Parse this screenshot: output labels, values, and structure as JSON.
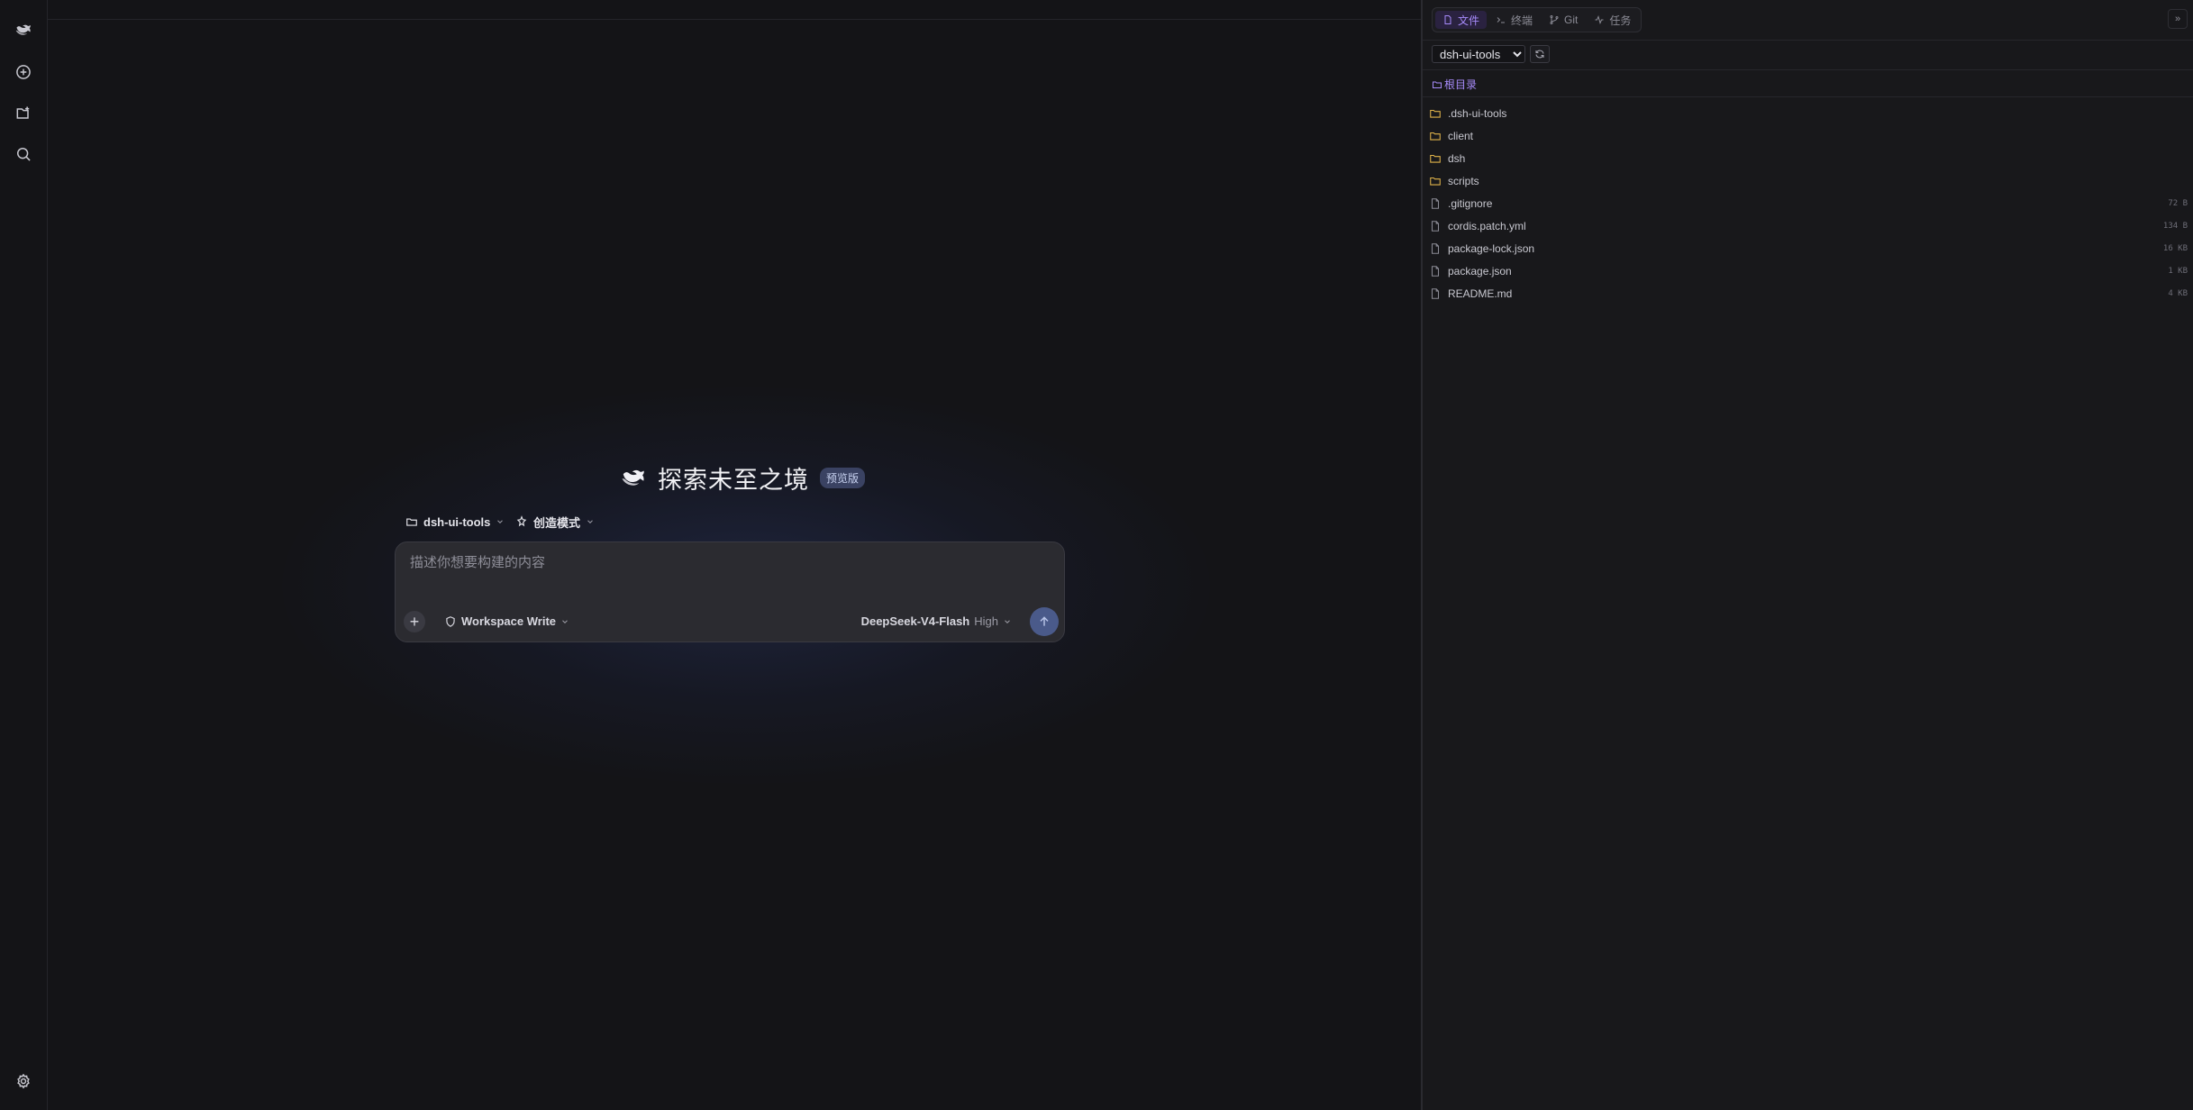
{
  "hero": {
    "title": "探索未至之境",
    "badge": "预览版"
  },
  "context": {
    "project": "dsh-ui-tools",
    "mode": "创造模式"
  },
  "composer": {
    "placeholder": "描述你想要构建的内容",
    "permission": "Workspace Write",
    "model": "DeepSeek-V4-Flash",
    "effort": "High"
  },
  "panel": {
    "tabs": [
      {
        "label": "文件",
        "icon": "file-icon",
        "active": true
      },
      {
        "label": "终端",
        "icon": "terminal-icon",
        "active": false
      },
      {
        "label": "Git",
        "icon": "git-branch-icon",
        "active": false
      },
      {
        "label": "任务",
        "icon": "activity-icon",
        "active": false
      }
    ],
    "collapse_label": "»",
    "project_select": "dsh-ui-tools",
    "breadcrumb": "根目录",
    "tree": [
      {
        "name": ".dsh-ui-tools",
        "type": "folder",
        "size": ""
      },
      {
        "name": "client",
        "type": "folder",
        "size": ""
      },
      {
        "name": "dsh",
        "type": "folder",
        "size": ""
      },
      {
        "name": "scripts",
        "type": "folder",
        "size": ""
      },
      {
        "name": ".gitignore",
        "type": "file",
        "size": "72 B"
      },
      {
        "name": "cordis.patch.yml",
        "type": "file",
        "size": "134 B"
      },
      {
        "name": "package-lock.json",
        "type": "file",
        "size": "16 KB"
      },
      {
        "name": "package.json",
        "type": "file",
        "size": "1 KB"
      },
      {
        "name": "README.md",
        "type": "file",
        "size": "4 KB"
      }
    ]
  },
  "colors": {
    "accent": "#a78bfa",
    "folder": "#e0b34a",
    "send": "#4a5a8a"
  }
}
